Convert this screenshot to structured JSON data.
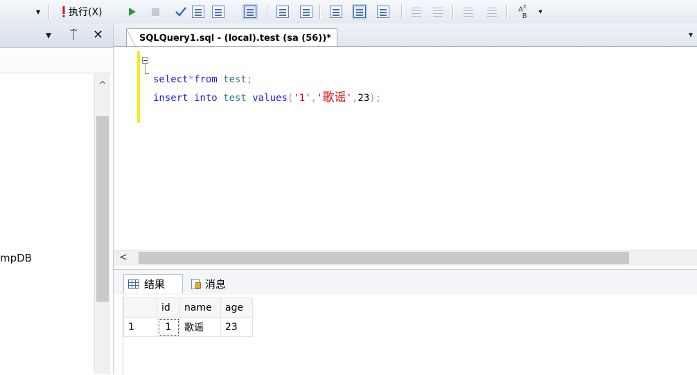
{
  "toolbar": {
    "execute_label": "执行(X)",
    "icons": [
      "dropdown-arrow-icon",
      "execute-exclamation-icon",
      "debug-play-icon",
      "stop-icon",
      "parse-checkmark-icon",
      "display-plan-icon",
      "query-designer-icon",
      "results-to-text-icon",
      "include-plan-icon",
      "client-stats-icon",
      "results-to-grid-icon",
      "results-to-file-icon",
      "comment-icon",
      "uncomment-icon",
      "decrease-indent-icon",
      "increase-indent-icon",
      "specify-values-icon"
    ]
  },
  "left_panel": {
    "pin_glyph": "ᛠ",
    "close_glyph": "✕",
    "dropdown_glyph": "▾",
    "scroll_up_glyph": "^",
    "tree_item_partial": "mpDB"
  },
  "editor": {
    "tab_title": "SQLQuery1.sql - (local).test (sa (56))*",
    "tab_dropdown_glyph": "▾",
    "line1": {
      "kw1": "select",
      "op1": "*",
      "kw2": "from",
      "id": "test",
      "op2": ";"
    },
    "line2": {
      "kw1": "insert",
      "kw2": "into",
      "id": "test",
      "kw3": "values",
      "op_open": "(",
      "str1": "'1'",
      "comma1": ",",
      "str2_q1": "'",
      "str2_cn": "歌谣",
      "str2_q2": "'",
      "comma2": ",",
      "num": "23",
      "op_close": ");"
    },
    "hscroll_left_glyph": "<"
  },
  "results": {
    "tab_results": "结果",
    "tab_messages": "消息",
    "columns": [
      "id",
      "name",
      "age"
    ],
    "rows": [
      {
        "row_number": "1",
        "id": "1",
        "name": "歌谣",
        "age": "23"
      }
    ]
  },
  "colors": {
    "keyword": "#1a1aff",
    "identifier": "#2b7b7b",
    "string": "#e00000",
    "margin_changed": "#f0ee1a"
  }
}
